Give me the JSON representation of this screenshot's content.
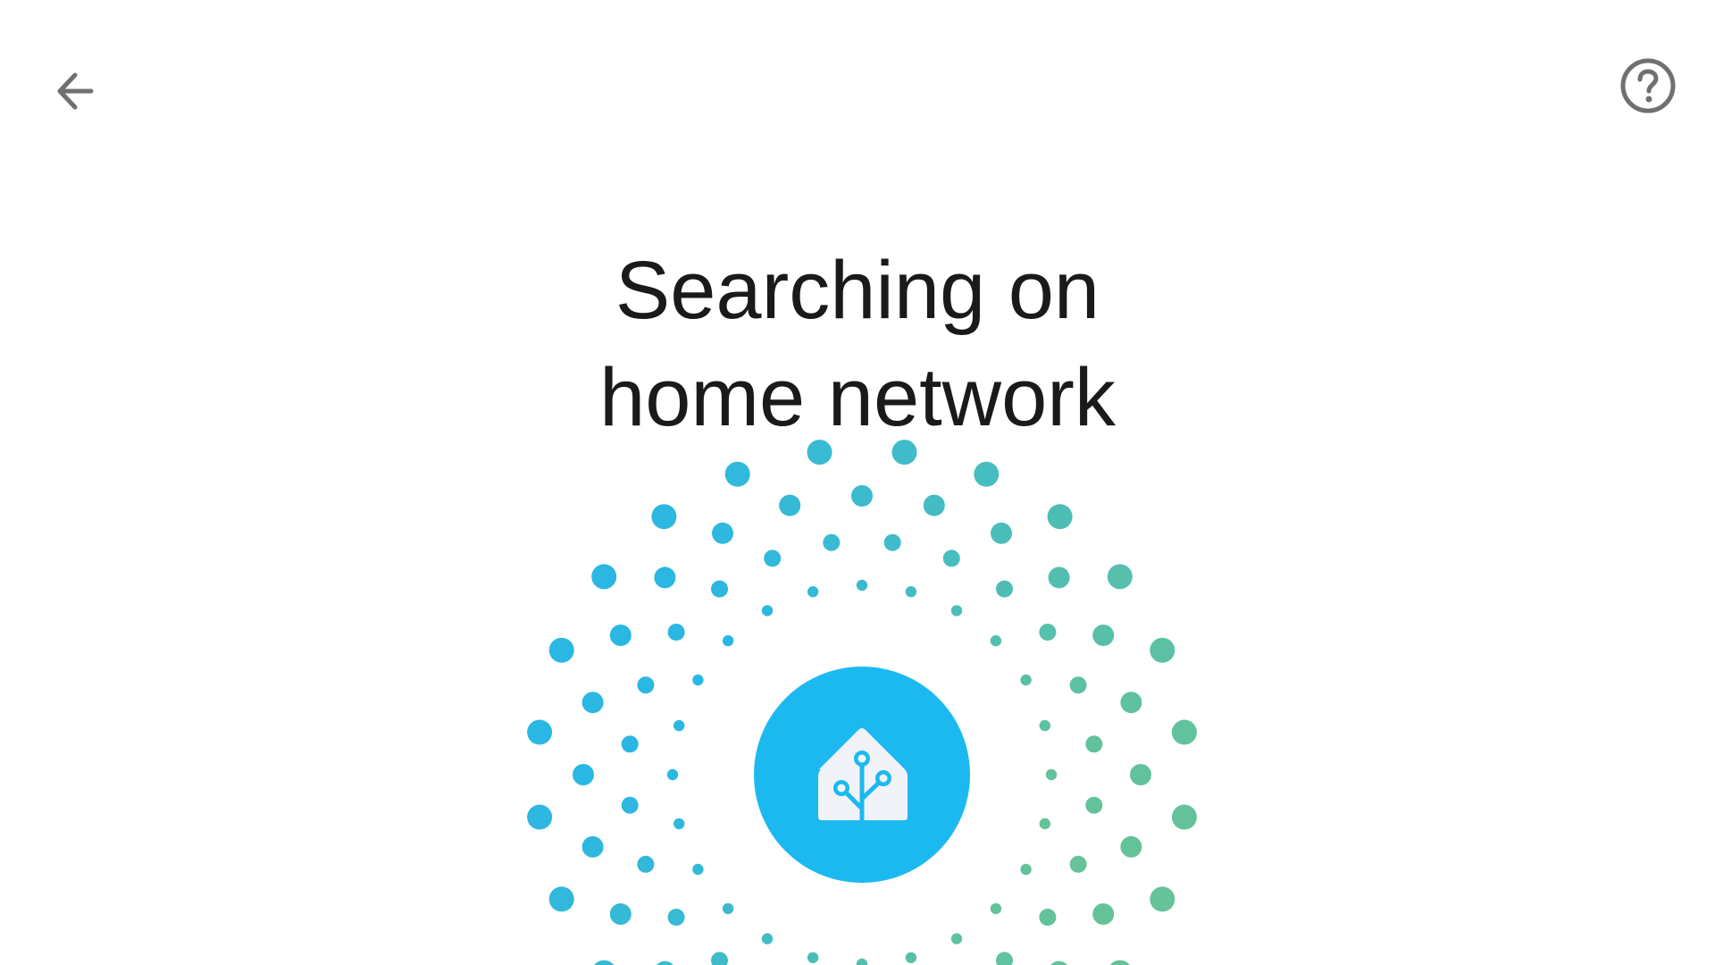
{
  "header": {
    "back_icon": "arrow-left-icon",
    "help_icon": "help-circle-icon"
  },
  "title": {
    "line1": "Searching on",
    "line2": "home network"
  },
  "hub": {
    "icon": "home-assistant-logo-icon",
    "color": "#1cb9f0"
  },
  "colors": {
    "icon_gray": "#707070",
    "text": "#1a1a1a",
    "dot_start": "#2bb7e3",
    "dot_end": "#6cc48f"
  }
}
